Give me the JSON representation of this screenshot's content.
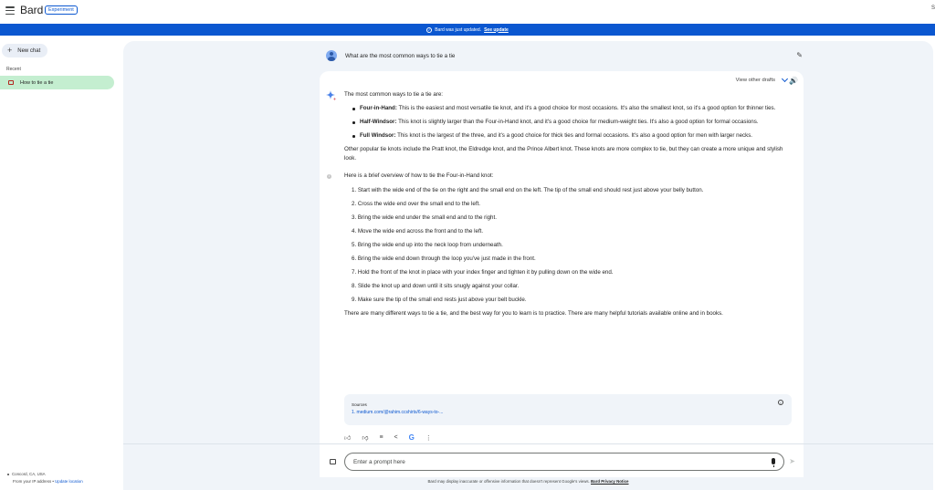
{
  "app": {
    "title": "Bard",
    "badge": "Experiment",
    "corner_char": "S"
  },
  "banner": {
    "text": "Bard was just updated.",
    "link": "See update"
  },
  "sidebar": {
    "new_chat": "New chat",
    "recent_label": "Recent",
    "recent_items": [
      {
        "label": "How to tie a tie"
      }
    ],
    "location": {
      "place": "Concord, CA, USA",
      "source": "From your IP address",
      "separator": " • ",
      "update_link": "Update location"
    }
  },
  "chat": {
    "question": "What are the most common ways to tie a tie",
    "drafts_label": "View other drafts",
    "response": {
      "intro": "The most common ways to tie a tie are:",
      "knots": [
        {
          "name": "Four-in-Hand:",
          "text": " This is the easiest and most versatile tie knot, and it's a good choice for most occasions. It's also the smallest knot, so it's a good option for thinner ties."
        },
        {
          "name": "Half-Windsor:",
          "text": " This knot is slightly larger than the Four-in-Hand knot, and it's a good choice for medium-weight ties. It's also a good option for formal occasions."
        },
        {
          "name": "Full Windsor:",
          "text": " This knot is the largest of the three, and it's a good choice for thick ties and formal occasions. It's also a good option for men with larger necks."
        }
      ],
      "other": "Other popular tie knots include the Pratt knot, the Eldredge knot, and the Prince Albert knot. These knots are more complex to tie, but they can create a more unique and stylish look.",
      "overview": "Here is a brief overview of how to tie the Four-in-Hand knot:",
      "steps": [
        "1. Start with the wide end of the tie on the right and the small end on the left. The tip of the small end should rest just above your belly button.",
        "2. Cross the wide end over the small end to the left.",
        "3. Bring the wide end under the small end and to the right.",
        "4. Move the wide end across the front and to the left.",
        "5. Bring the wide end up into the neck loop from underneath.",
        "6. Bring the wide end down through the loop you've just made in the front.",
        "7. Hold the front of the knot in place with your index finger and tighten it by pulling down on the wide end.",
        "8. Slide the knot up and down until it sits snugly against your collar.",
        "9. Make sure the tip of the small end rests just above your belt buckle."
      ],
      "closing": "There are many different ways to tie a tie, and the best way for you to learn is to practice. There are many helpful tutorials available online and in books."
    },
    "sources": {
      "title": "Sources",
      "items": [
        "1. medium.com/@rahim.ccshirts/6-ways-to-..."
      ]
    }
  },
  "prompt": {
    "placeholder": "Enter a prompt here"
  },
  "footer": {
    "disclaimer": "Bard may display inaccurate or offensive information that doesn't represent Google's views. ",
    "link": "Bard Privacy Notice"
  },
  "colors": {
    "accent": "#0b57d0",
    "main_bg": "#f0f4f9",
    "recent_active": "#c4eed0"
  }
}
